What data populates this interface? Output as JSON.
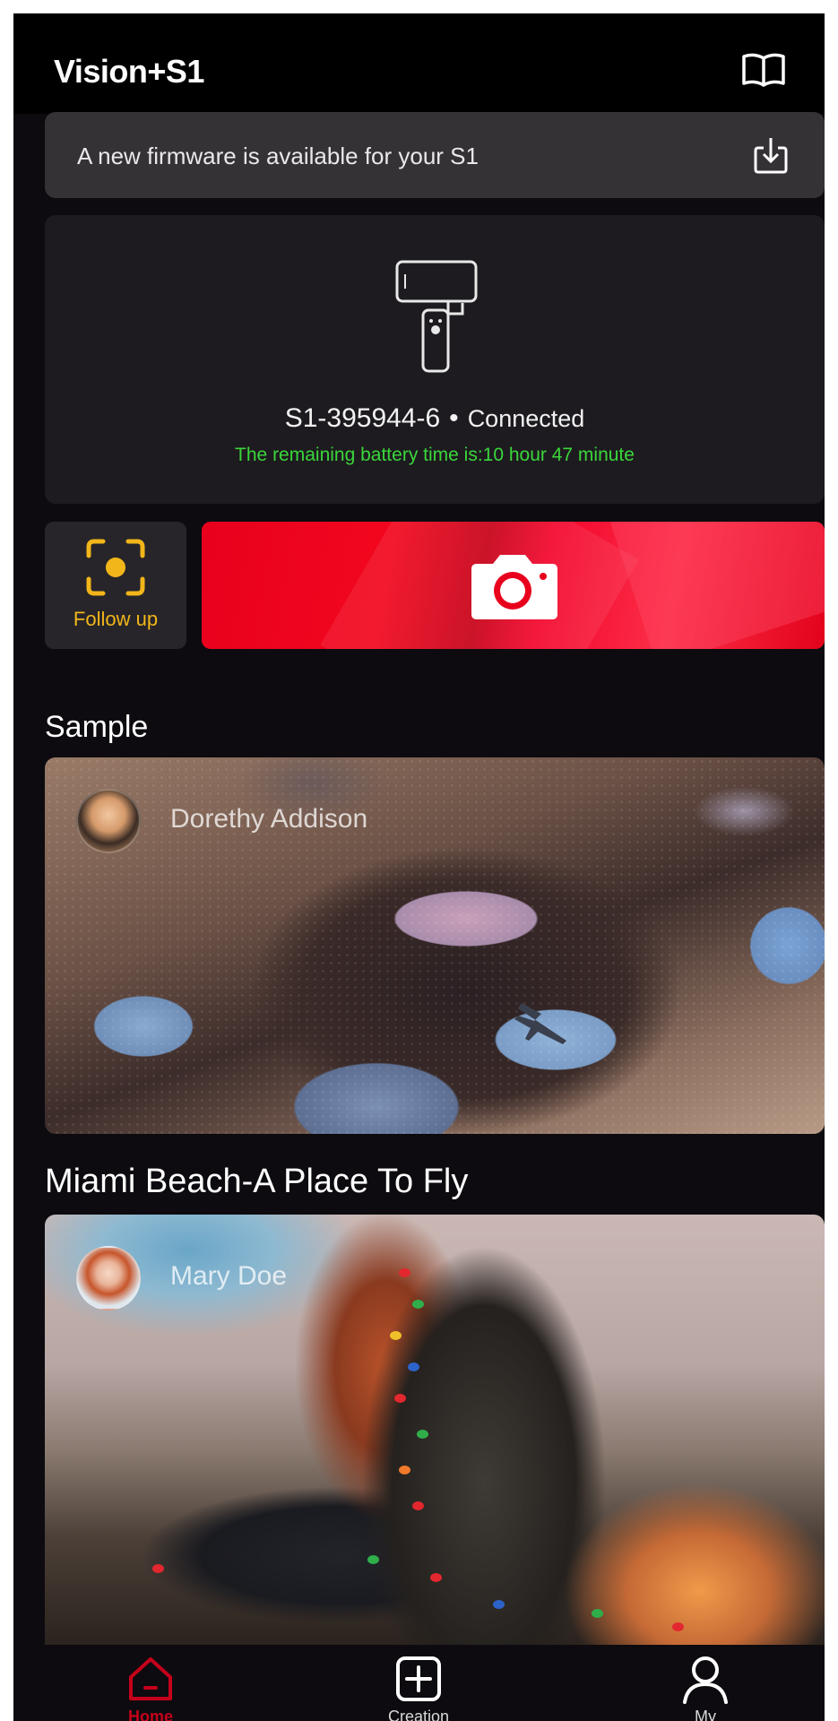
{
  "header": {
    "title": "Vision+S1",
    "guide_icon": "book-icon"
  },
  "firmware_banner": {
    "text": "A new firmware is available for your S1",
    "icon": "download-icon"
  },
  "device": {
    "name": "S1-395944-6",
    "separator": "•",
    "status": "Connected",
    "battery_text": "The remaining battery time is:10 hour 47 minute",
    "icon": "gimbal-phone-icon"
  },
  "controls": {
    "follow_label": "Follow up",
    "follow_icon": "face-tracking-icon",
    "shoot_icon": "camera-icon"
  },
  "sample": {
    "title": "Sample",
    "cards": [
      {
        "author": "Dorethy Addison",
        "caption": "Miami Beach-A Place To Fly"
      },
      {
        "author": "Mary Doe"
      }
    ]
  },
  "nav": {
    "items": [
      {
        "label": "Home",
        "icon": "home-icon"
      },
      {
        "label": "Creation",
        "icon": "plus-square-icon"
      },
      {
        "label": "My",
        "icon": "person-icon"
      }
    ]
  },
  "colors": {
    "accent_red": "#e8001d",
    "battery_green": "#3bd63b",
    "follow_yellow": "#f2b61a",
    "background": "#0d0b0f"
  }
}
